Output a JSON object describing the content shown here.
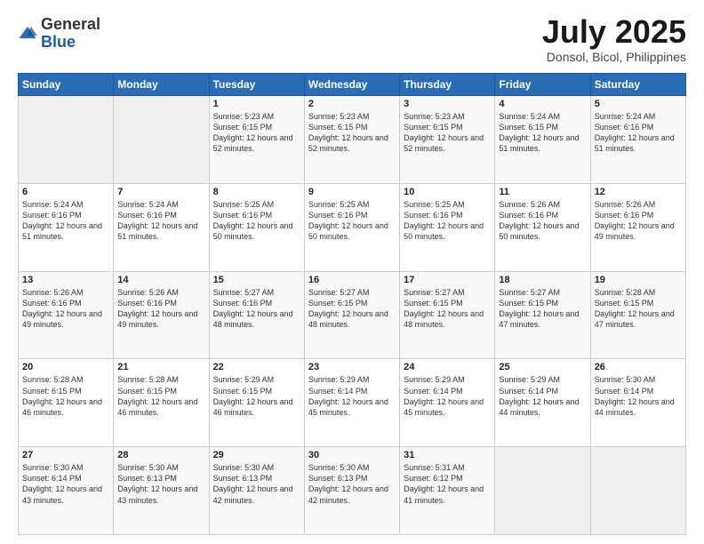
{
  "logo": {
    "general": "General",
    "blue": "Blue"
  },
  "header": {
    "month": "July 2025",
    "location": "Donsol, Bicol, Philippines"
  },
  "weekdays": [
    "Sunday",
    "Monday",
    "Tuesday",
    "Wednesday",
    "Thursday",
    "Friday",
    "Saturday"
  ],
  "weeks": [
    [
      {
        "day": "",
        "sunrise": "",
        "sunset": "",
        "daylight": ""
      },
      {
        "day": "",
        "sunrise": "",
        "sunset": "",
        "daylight": ""
      },
      {
        "day": "1",
        "sunrise": "Sunrise: 5:23 AM",
        "sunset": "Sunset: 6:15 PM",
        "daylight": "Daylight: 12 hours and 52 minutes."
      },
      {
        "day": "2",
        "sunrise": "Sunrise: 5:23 AM",
        "sunset": "Sunset: 6:15 PM",
        "daylight": "Daylight: 12 hours and 52 minutes."
      },
      {
        "day": "3",
        "sunrise": "Sunrise: 5:23 AM",
        "sunset": "Sunset: 6:15 PM",
        "daylight": "Daylight: 12 hours and 52 minutes."
      },
      {
        "day": "4",
        "sunrise": "Sunrise: 5:24 AM",
        "sunset": "Sunset: 6:15 PM",
        "daylight": "Daylight: 12 hours and 51 minutes."
      },
      {
        "day": "5",
        "sunrise": "Sunrise: 5:24 AM",
        "sunset": "Sunset: 6:16 PM",
        "daylight": "Daylight: 12 hours and 51 minutes."
      }
    ],
    [
      {
        "day": "6",
        "sunrise": "Sunrise: 5:24 AM",
        "sunset": "Sunset: 6:16 PM",
        "daylight": "Daylight: 12 hours and 51 minutes."
      },
      {
        "day": "7",
        "sunrise": "Sunrise: 5:24 AM",
        "sunset": "Sunset: 6:16 PM",
        "daylight": "Daylight: 12 hours and 51 minutes."
      },
      {
        "day": "8",
        "sunrise": "Sunrise: 5:25 AM",
        "sunset": "Sunset: 6:16 PM",
        "daylight": "Daylight: 12 hours and 50 minutes."
      },
      {
        "day": "9",
        "sunrise": "Sunrise: 5:25 AM",
        "sunset": "Sunset: 6:16 PM",
        "daylight": "Daylight: 12 hours and 50 minutes."
      },
      {
        "day": "10",
        "sunrise": "Sunrise: 5:25 AM",
        "sunset": "Sunset: 6:16 PM",
        "daylight": "Daylight: 12 hours and 50 minutes."
      },
      {
        "day": "11",
        "sunrise": "Sunrise: 5:26 AM",
        "sunset": "Sunset: 6:16 PM",
        "daylight": "Daylight: 12 hours and 50 minutes."
      },
      {
        "day": "12",
        "sunrise": "Sunrise: 5:26 AM",
        "sunset": "Sunset: 6:16 PM",
        "daylight": "Daylight: 12 hours and 49 minutes."
      }
    ],
    [
      {
        "day": "13",
        "sunrise": "Sunrise: 5:26 AM",
        "sunset": "Sunset: 6:16 PM",
        "daylight": "Daylight: 12 hours and 49 minutes."
      },
      {
        "day": "14",
        "sunrise": "Sunrise: 5:26 AM",
        "sunset": "Sunset: 6:16 PM",
        "daylight": "Daylight: 12 hours and 49 minutes."
      },
      {
        "day": "15",
        "sunrise": "Sunrise: 5:27 AM",
        "sunset": "Sunset: 6:16 PM",
        "daylight": "Daylight: 12 hours and 48 minutes."
      },
      {
        "day": "16",
        "sunrise": "Sunrise: 5:27 AM",
        "sunset": "Sunset: 6:15 PM",
        "daylight": "Daylight: 12 hours and 48 minutes."
      },
      {
        "day": "17",
        "sunrise": "Sunrise: 5:27 AM",
        "sunset": "Sunset: 6:15 PM",
        "daylight": "Daylight: 12 hours and 48 minutes."
      },
      {
        "day": "18",
        "sunrise": "Sunrise: 5:27 AM",
        "sunset": "Sunset: 6:15 PM",
        "daylight": "Daylight: 12 hours and 47 minutes."
      },
      {
        "day": "19",
        "sunrise": "Sunrise: 5:28 AM",
        "sunset": "Sunset: 6:15 PM",
        "daylight": "Daylight: 12 hours and 47 minutes."
      }
    ],
    [
      {
        "day": "20",
        "sunrise": "Sunrise: 5:28 AM",
        "sunset": "Sunset: 6:15 PM",
        "daylight": "Daylight: 12 hours and 46 minutes."
      },
      {
        "day": "21",
        "sunrise": "Sunrise: 5:28 AM",
        "sunset": "Sunset: 6:15 PM",
        "daylight": "Daylight: 12 hours and 46 minutes."
      },
      {
        "day": "22",
        "sunrise": "Sunrise: 5:29 AM",
        "sunset": "Sunset: 6:15 PM",
        "daylight": "Daylight: 12 hours and 46 minutes."
      },
      {
        "day": "23",
        "sunrise": "Sunrise: 5:29 AM",
        "sunset": "Sunset: 6:14 PM",
        "daylight": "Daylight: 12 hours and 45 minutes."
      },
      {
        "day": "24",
        "sunrise": "Sunrise: 5:29 AM",
        "sunset": "Sunset: 6:14 PM",
        "daylight": "Daylight: 12 hours and 45 minutes."
      },
      {
        "day": "25",
        "sunrise": "Sunrise: 5:29 AM",
        "sunset": "Sunset: 6:14 PM",
        "daylight": "Daylight: 12 hours and 44 minutes."
      },
      {
        "day": "26",
        "sunrise": "Sunrise: 5:30 AM",
        "sunset": "Sunset: 6:14 PM",
        "daylight": "Daylight: 12 hours and 44 minutes."
      }
    ],
    [
      {
        "day": "27",
        "sunrise": "Sunrise: 5:30 AM",
        "sunset": "Sunset: 6:14 PM",
        "daylight": "Daylight: 12 hours and 43 minutes."
      },
      {
        "day": "28",
        "sunrise": "Sunrise: 5:30 AM",
        "sunset": "Sunset: 6:13 PM",
        "daylight": "Daylight: 12 hours and 43 minutes."
      },
      {
        "day": "29",
        "sunrise": "Sunrise: 5:30 AM",
        "sunset": "Sunset: 6:13 PM",
        "daylight": "Daylight: 12 hours and 42 minutes."
      },
      {
        "day": "30",
        "sunrise": "Sunrise: 5:30 AM",
        "sunset": "Sunset: 6:13 PM",
        "daylight": "Daylight: 12 hours and 42 minutes."
      },
      {
        "day": "31",
        "sunrise": "Sunrise: 5:31 AM",
        "sunset": "Sunset: 6:12 PM",
        "daylight": "Daylight: 12 hours and 41 minutes."
      },
      {
        "day": "",
        "sunrise": "",
        "sunset": "",
        "daylight": ""
      },
      {
        "day": "",
        "sunrise": "",
        "sunset": "",
        "daylight": ""
      }
    ]
  ]
}
